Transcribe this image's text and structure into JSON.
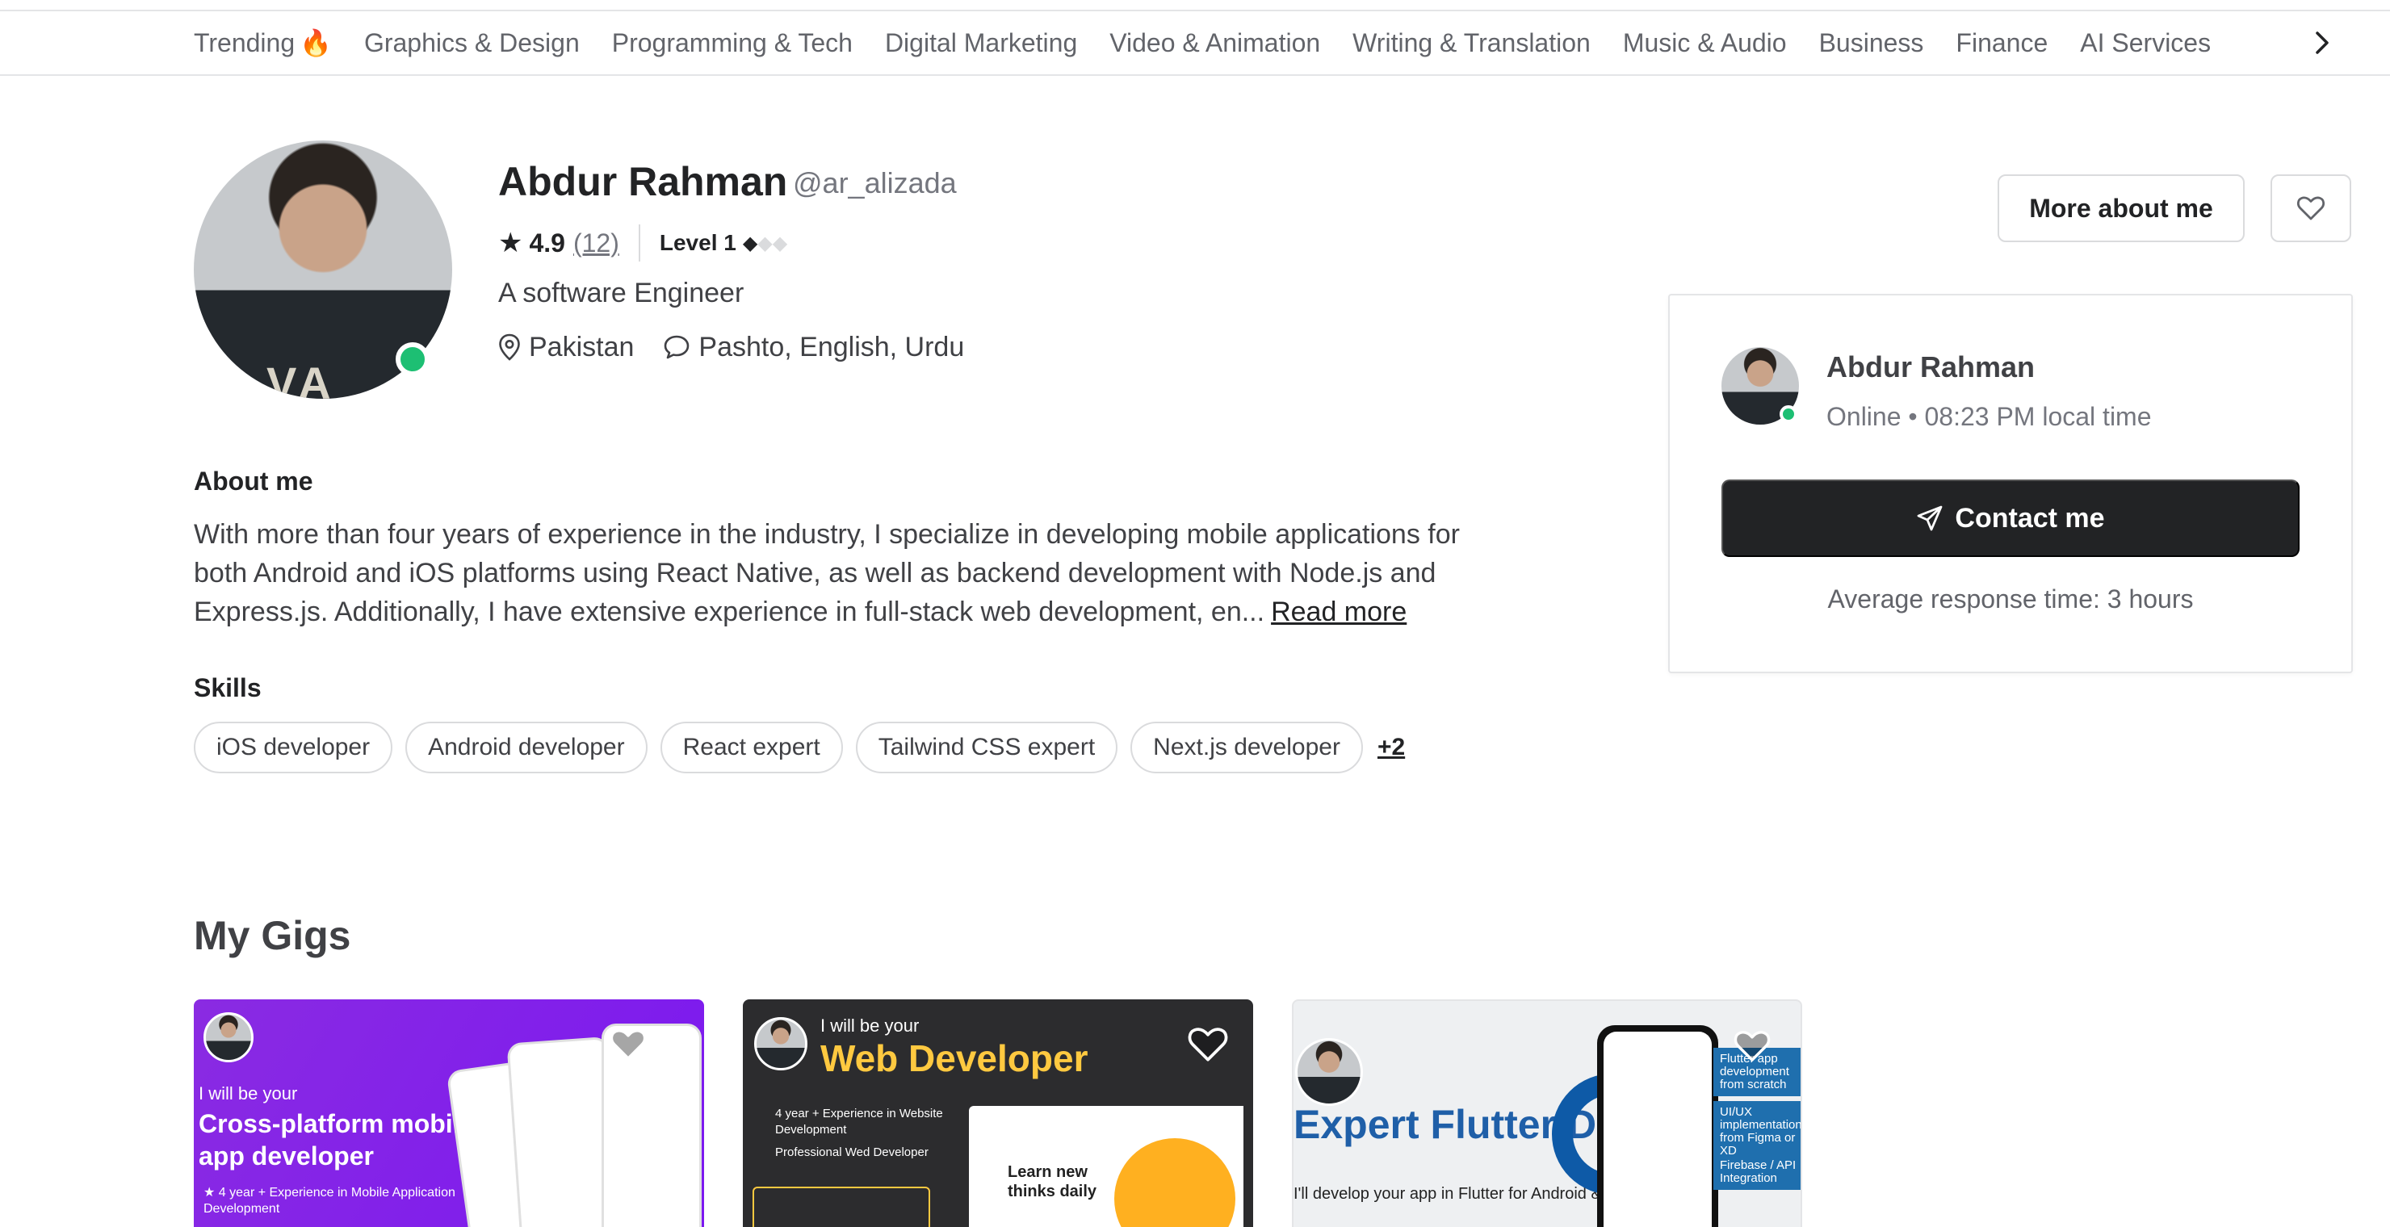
{
  "nav": {
    "categories": [
      {
        "label": "Trending",
        "icon": "fire-icon"
      },
      {
        "label": "Graphics & Design"
      },
      {
        "label": "Programming & Tech"
      },
      {
        "label": "Digital Marketing"
      },
      {
        "label": "Video & Animation"
      },
      {
        "label": "Writing & Translation"
      },
      {
        "label": "Music & Audio"
      },
      {
        "label": "Business"
      },
      {
        "label": "Finance"
      },
      {
        "label": "AI Services"
      }
    ],
    "trending_emoji": "🔥"
  },
  "profile": {
    "name": "Abdur Rahman",
    "handle": "@ar_alizada",
    "rating": "4.9",
    "review_count": "(12)",
    "level": "Level 1",
    "level_filled": 1,
    "level_total": 3,
    "tagline": "A software Engineer",
    "country": "Pakistan",
    "languages": "Pashto, English, Urdu",
    "online": true
  },
  "actions": {
    "more_about_me": "More about me"
  },
  "contact_card": {
    "name": "Abdur Rahman",
    "status": "Online • 08:23 PM local time",
    "contact_button": "Contact me",
    "response_time": "Average response time: 3 hours"
  },
  "about": {
    "title": "About me",
    "text": "With more than four years of experience in the industry, I specialize in developing mobile applications for both Android and iOS platforms using React Native, as well as backend development with Node.js and Express.js. Additionally, I have extensive experience in full-stack web development, en...",
    "read_more": "Read more"
  },
  "skills": {
    "title": "Skills",
    "items": [
      "iOS developer",
      "Android developer",
      "React expert",
      "Tailwind CSS expert",
      "Next.js developer"
    ],
    "more": "+2"
  },
  "gigs": {
    "title": "My Gigs",
    "items": [
      {
        "small": "I will be your",
        "big": "Cross-platform mobile app developer",
        "bullet": "4 year + Experience in Mobile Application Development"
      },
      {
        "small": "I will be your",
        "big": "Web Developer",
        "bullet1": "4 year + Experience in Website Development",
        "bullet2": "Professional Wed Developer",
        "panel_title": "Learn new thinks daily"
      },
      {
        "big": "Expert Flutter Developer",
        "sub": "I'll develop your app in Flutter for Android & iOS",
        "tag1": "Flutter app development from scratch",
        "tag2": "UI/UX implementation from Figma or XD",
        "tag3": "Firebase / API Integration"
      }
    ]
  },
  "colors": {
    "online": "#1dbf73",
    "primary_dark": "#222325",
    "gig1_bg": "#8a2be2",
    "gig2_accent": "#ffc940",
    "gig3_title": "#1f5fa8"
  }
}
